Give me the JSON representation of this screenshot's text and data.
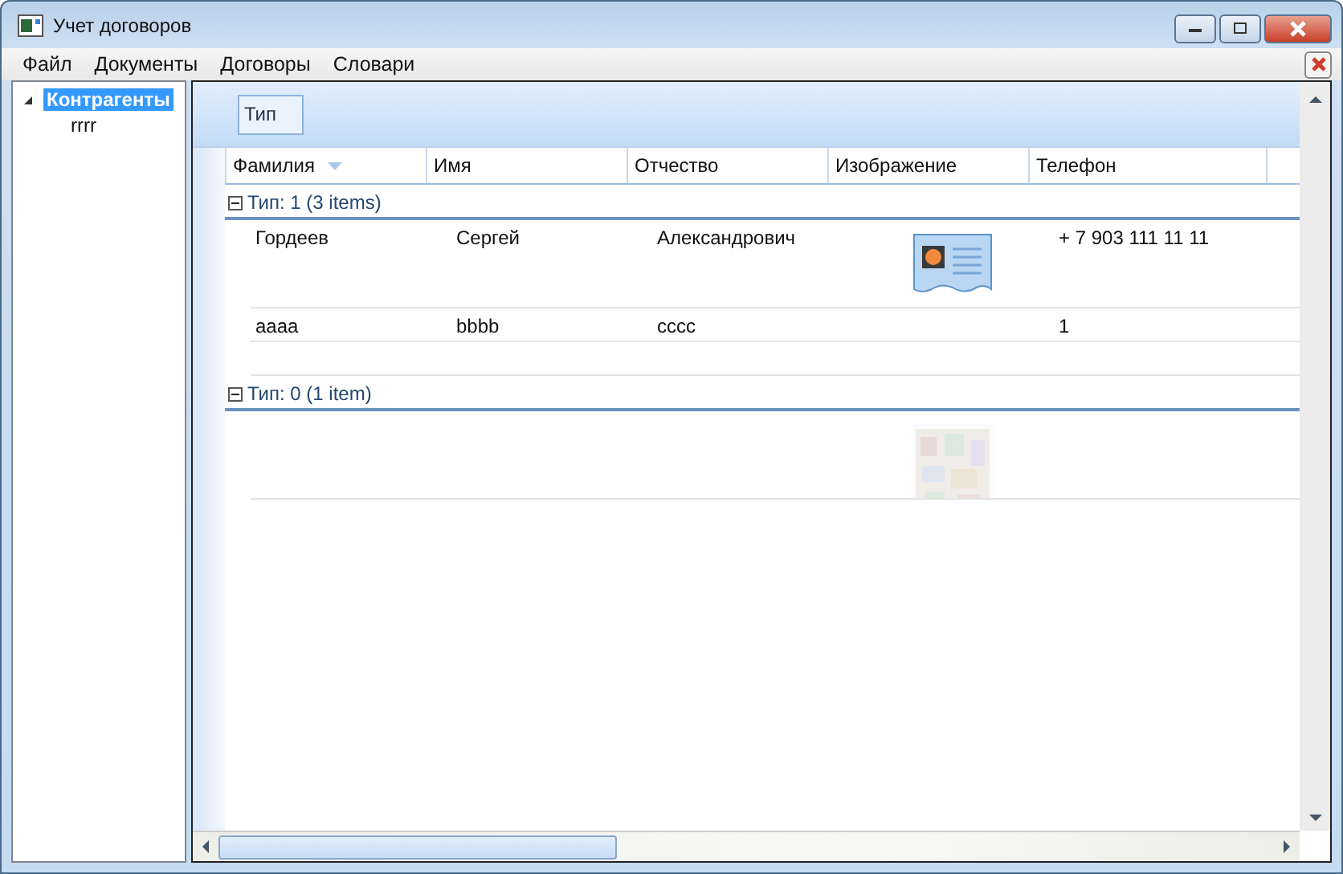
{
  "window": {
    "title": "Учет договоров"
  },
  "menu": [
    "Файл",
    "Документы",
    "Договоры",
    "Словари"
  ],
  "tree": [
    {
      "label": "Контрагенты",
      "selected": true,
      "expanded": true,
      "children": [
        {
          "label": "rrrr",
          "selected": false
        }
      ]
    }
  ],
  "grid": {
    "group_panel": [
      "Тип"
    ],
    "columns": [
      {
        "label": "Фамилия",
        "sorted": true
      },
      {
        "label": "Имя",
        "sorted": false
      },
      {
        "label": "Отчество",
        "sorted": false
      },
      {
        "label": "Изображение",
        "sorted": false
      },
      {
        "label": "Телефон",
        "sorted": false
      }
    ],
    "groups": [
      {
        "header": "Тип: 1 (3 items)",
        "expanded": true,
        "rows": [
          {
            "cells": [
              "Гордеев",
              "Сергей",
              "Александрович",
              "",
              "+ 7 903 111 11 11"
            ],
            "image": {
              "kind": "icon"
            }
          },
          {
            "cells": [
              "aaaa",
              "bbbb",
              "cccc",
              "",
              "1"
            ]
          },
          {
            "cells": []
          }
        ]
      },
      {
        "header": "Тип: 0 (1 item)",
        "expanded": true,
        "rows": [
          {
            "cells": [],
            "image": {
              "kind": "picture"
            }
          }
        ]
      }
    ]
  }
}
